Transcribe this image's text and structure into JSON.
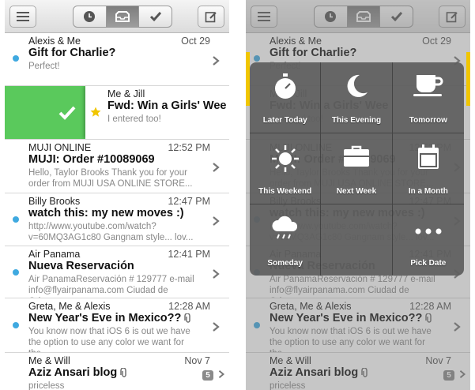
{
  "colors": {
    "unread_dot": "#3fa9e0",
    "archive_green": "#5ac95c",
    "star_yellow": "#f1c600",
    "overlay_gray": "#5f5f5f"
  },
  "toolbar": {
    "icons": [
      "menu-icon",
      "clock-icon",
      "inbox-icon",
      "check-icon",
      "compose-icon"
    ],
    "active_segment": "inbox"
  },
  "messages": [
    {
      "sender": "Alexis & Me",
      "date": "Oct 29",
      "subject": "Gift for Charlie?",
      "preview": "Perfect!",
      "unread": true
    },
    {
      "sender": "Me & Jill",
      "date": "",
      "subject": "Fwd: Win a Girls' Wee",
      "preview": "I entered too!",
      "starred": true,
      "swiped": true
    },
    {
      "sender": "MUJI ONLINE",
      "date": "12:52 PM",
      "subject": "MUJI: Order #10089069",
      "preview": "Hello, Taylor Brooks Thank you for your order from MUJI USA ONLINE STORE...",
      "unread": false
    },
    {
      "sender": "Billy Brooks",
      "date": "12:47 PM",
      "subject": "watch this: my new moves :)",
      "preview": "http://www.youtube.com/watch?v=60MQ3AG1c80 Gangnam style... lov...",
      "unread": true
    },
    {
      "sender": "Air Panama",
      "date": "12:41 PM",
      "subject": "Nueva Reservación",
      "preview": "Air PanamaReservación # 129777 e-mail info@flyairpanama.com Ciudad de Orig...",
      "unread": true
    },
    {
      "sender": "Greta, Me & Alexis",
      "date": "12:28 AM",
      "subject": "New Year's Eve in Mexico??",
      "preview": "You know now that iOS 6 is out we have the option to use any color we want for the...",
      "unread": true,
      "attachment": true
    },
    {
      "sender": "Me & Will",
      "date": "Nov 7",
      "subject": "Aziz Ansari blog",
      "preview": "priceless",
      "count": "5",
      "attachment": true
    }
  ],
  "snooze_options": [
    {
      "label": "Later Today",
      "icon": "stopwatch-icon"
    },
    {
      "label": "This Evening",
      "icon": "moon-icon"
    },
    {
      "label": "Tomorrow",
      "icon": "coffee-cup-icon"
    },
    {
      "label": "This Weekend",
      "icon": "sun-icon"
    },
    {
      "label": "Next Week",
      "icon": "briefcase-icon"
    },
    {
      "label": "In a Month",
      "icon": "calendar-icon"
    },
    {
      "label": "Someday",
      "icon": "cloud-rain-icon"
    },
    {
      "label": "",
      "icon": ""
    },
    {
      "label": "Pick Date",
      "icon": "more-dots-icon"
    }
  ]
}
